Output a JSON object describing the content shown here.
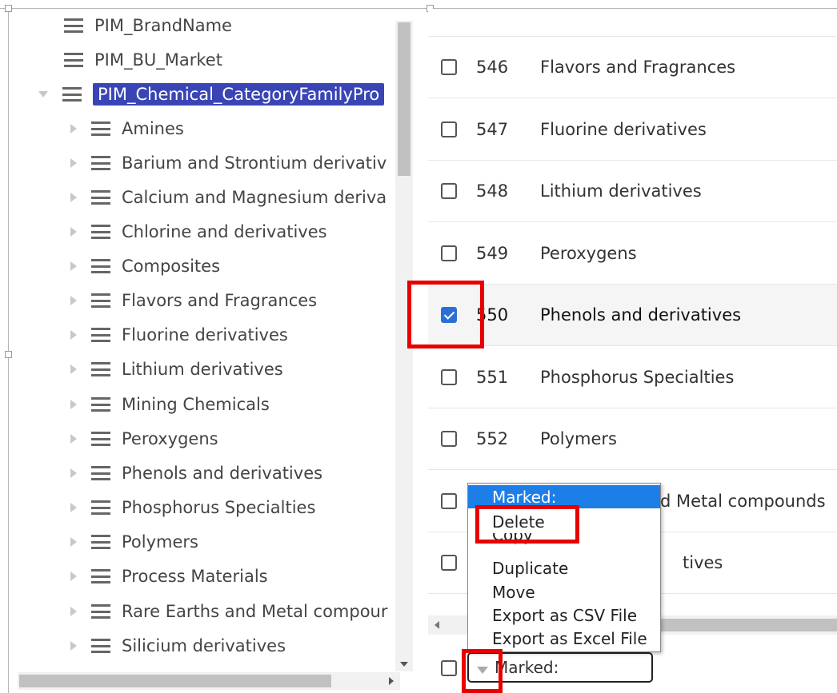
{
  "tree": {
    "items": [
      {
        "label": "PIM_BrandName",
        "level": 0,
        "expander": "none",
        "selected": false
      },
      {
        "label": "PIM_BU_Market",
        "level": 0,
        "expander": "none",
        "selected": false
      },
      {
        "label": "PIM_Chemical_CategoryFamilyPro",
        "level": 0,
        "expander": "expanded",
        "selected": true
      },
      {
        "label": "Amines",
        "level": 1,
        "expander": "collapsed",
        "selected": false
      },
      {
        "label": "Barium and Strontium derivativ",
        "level": 1,
        "expander": "collapsed",
        "selected": false
      },
      {
        "label": "Calcium and Magnesium deriva",
        "level": 1,
        "expander": "collapsed",
        "selected": false
      },
      {
        "label": "Chlorine and derivatives",
        "level": 1,
        "expander": "collapsed",
        "selected": false
      },
      {
        "label": "Composites",
        "level": 1,
        "expander": "collapsed",
        "selected": false
      },
      {
        "label": "Flavors and Fragrances",
        "level": 1,
        "expander": "collapsed",
        "selected": false
      },
      {
        "label": "Fluorine derivatives",
        "level": 1,
        "expander": "collapsed",
        "selected": false
      },
      {
        "label": "Lithium derivatives",
        "level": 1,
        "expander": "collapsed",
        "selected": false
      },
      {
        "label": "Mining Chemicals",
        "level": 1,
        "expander": "collapsed",
        "selected": false
      },
      {
        "label": "Peroxygens",
        "level": 1,
        "expander": "collapsed",
        "selected": false
      },
      {
        "label": "Phenols and derivatives",
        "level": 1,
        "expander": "collapsed",
        "selected": false
      },
      {
        "label": "Phosphorus Specialties",
        "level": 1,
        "expander": "collapsed",
        "selected": false
      },
      {
        "label": "Polymers",
        "level": 1,
        "expander": "collapsed",
        "selected": false
      },
      {
        "label": "Process Materials",
        "level": 1,
        "expander": "collapsed",
        "selected": false
      },
      {
        "label": "Rare Earths and Metal compour",
        "level": 1,
        "expander": "collapsed",
        "selected": false
      },
      {
        "label": "Silicium derivatives",
        "level": 1,
        "expander": "collapsed",
        "selected": false
      }
    ]
  },
  "grid": {
    "rows": [
      {
        "id": "546",
        "name": "Flavors and Fragrances",
        "checked": false
      },
      {
        "id": "547",
        "name": "Fluorine derivatives",
        "checked": false
      },
      {
        "id": "548",
        "name": "Lithium derivatives",
        "checked": false
      },
      {
        "id": "549",
        "name": "Peroxygens",
        "checked": false
      },
      {
        "id": "550",
        "name": "Phenols and derivatives",
        "checked": true
      },
      {
        "id": "551",
        "name": "Phosphorus Specialties",
        "checked": false
      },
      {
        "id": "552",
        "name": "Polymers",
        "checked": false
      },
      {
        "id": "",
        "name": "d Metal compounds",
        "checked": false
      },
      {
        "id": "",
        "name": "tives",
        "checked": false
      }
    ]
  },
  "context_menu": {
    "header": "Marked:",
    "items": [
      "Delete",
      "Copy",
      "Duplicate",
      "Move",
      "Export as CSV File",
      "Export as Excel File"
    ]
  },
  "marked_select": {
    "value": "Marked:"
  },
  "colors": {
    "selection": "#3a45b5",
    "menu_highlight": "#1e7ee8",
    "checkbox_checked": "#2b6fd6",
    "annotation_red": "#e80000"
  }
}
